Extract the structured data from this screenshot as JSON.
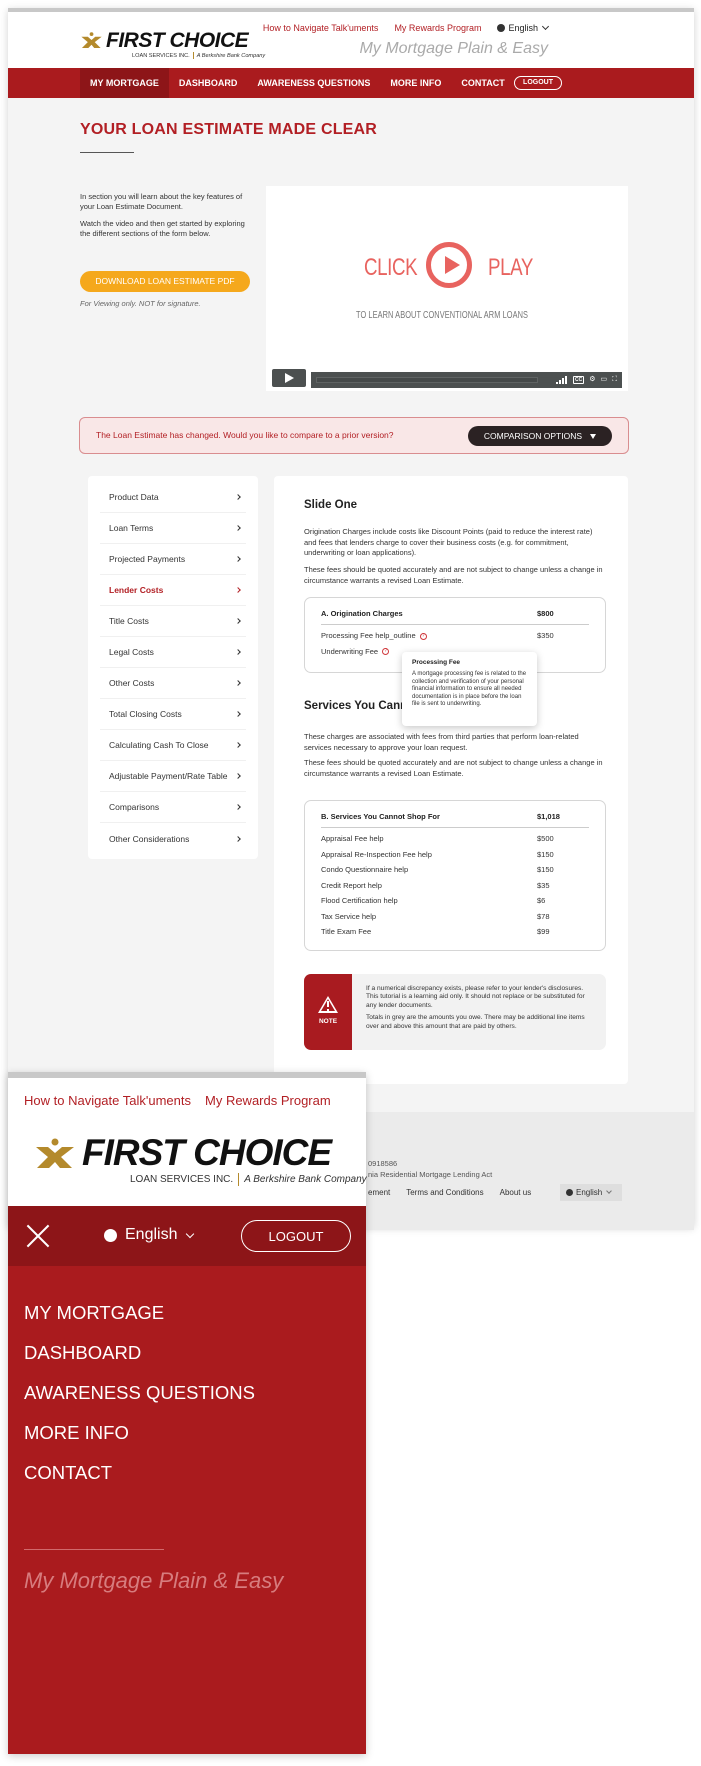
{
  "brand": {
    "name": "FIRST CHOICE",
    "subtitle": "LOAN SERVICES INC.",
    "parent": "A Berkshire Bank Company",
    "tagline": "My Mortgage Plain & Easy",
    "colors": {
      "primary": "#aa1b1e",
      "primary_dark": "#8d1518",
      "accent": "#f5a81c",
      "gold": "#b48a2c"
    }
  },
  "header": {
    "links": [
      "How to Navigate Talk'uments",
      "My Rewards Program"
    ],
    "language": "English"
  },
  "nav": {
    "items": [
      "MY MORTGAGE",
      "DASHBOARD",
      "AWARENESS QUESTIONS",
      "MORE INFO",
      "CONTACT"
    ],
    "active": "MY MORTGAGE",
    "logout": "LOGOUT"
  },
  "page": {
    "title": "YOUR LOAN ESTIMATE MADE CLEAR",
    "intro": [
      "In section you will learn about the key features of your Loan Estimate Document.",
      "Watch the video and then get started by exploring the different sections of the form below."
    ],
    "download_button": "DOWNLOAD LOAN ESTIMATE PDF",
    "download_note": "For Viewing only. NOT for signature."
  },
  "video": {
    "word_left": "CLICK",
    "word_right": "PLAY",
    "subtitle": "TO LEARN ABOUT CONVENTIONAL ARM LOANS",
    "cc_label": "CC"
  },
  "alert": {
    "message": "The Loan Estimate has changed. Would you like to compare to a prior version?",
    "button": "COMPARISON OPTIONS"
  },
  "sidebar": {
    "items": [
      "Product Data",
      "Loan Terms",
      "Projected Payments",
      "Lender Costs",
      "Title Costs",
      "Legal Costs",
      "Other Costs",
      "Total Closing Costs",
      "Calculating Cash To Close",
      "Adjustable Payment/Rate Table",
      "Comparisons",
      "Other Considerations"
    ],
    "active": "Lender Costs"
  },
  "content": {
    "slide_title": "Slide One",
    "slide_paras": [
      "Origination Charges include costs like Discount Points (paid to reduce the interest rate) and fees that lenders charge to cover their business costs (e.g. for commitment, underwriting or loan applications).",
      "These fees should be quoted accurately and are not subject to change unless a change in circumstance warrants a revised Loan Estimate."
    ],
    "origination": {
      "title": "A. Origination Charges",
      "total": "$800",
      "rows": [
        {
          "label": "Processing Fee help_outline",
          "value": "$350",
          "help": true
        },
        {
          "label": "Underwriting Fee",
          "value": "",
          "help": true
        }
      ]
    },
    "tooltip": {
      "title": "Processing Fee",
      "body": "A mortgage processing fee is related to the collection and verification of your personal financial information to ensure all needed documentation is in place before the loan file is sent to underwriting."
    },
    "services_title": "Services You Cannot Shop For",
    "services_paras": [
      "These charges are associated with fees from third parties that perform loan-related services necessary to approve your loan request.",
      "These fees should be quoted accurately and are not subject to change unless a change in circumstance warrants a revised Loan Estimate."
    ],
    "services": {
      "title": "B. Services You Cannot Shop For",
      "total": "$1,018",
      "rows": [
        {
          "label": "Appraisal Fee help",
          "value": "$500"
        },
        {
          "label": "Appraisal Re-Inspection Fee help",
          "value": "$150"
        },
        {
          "label": "Condo Questionnaire help",
          "value": "$150"
        },
        {
          "label": "Credit Report help",
          "value": "$35"
        },
        {
          "label": "Flood Certification help",
          "value": "$6"
        },
        {
          "label": "Tax Service help",
          "value": "$78"
        },
        {
          "label": "Title Exam Fee",
          "value": "$99"
        }
      ]
    },
    "note": {
      "label": "NOTE",
      "paras": [
        "If a numerical discrepancy exists, please refer to your lender's disclosures. This tutorial is a learning aid only. It should not replace or be substituted for any lender documents.",
        "Totals in grey are the amounts you owe. There may be additional line items over and above this amount that are paid by others."
      ]
    }
  },
  "footer": {
    "nmls_line": "0918586",
    "license_line": "nia Residential Mortgage Lending Act",
    "links": [
      "ement",
      "Terms and Conditions",
      "About us"
    ],
    "language": "English"
  },
  "mobile": {
    "links": [
      "How to Navigate Talk'uments",
      "My Rewards Program"
    ],
    "language": "English",
    "logout": "LOGOUT",
    "menu": [
      "MY MORTGAGE",
      "DASHBOARD",
      "AWARENESS QUESTIONS",
      "MORE INFO",
      "CONTACT"
    ],
    "tagline": "My Mortgage Plain & Easy"
  }
}
